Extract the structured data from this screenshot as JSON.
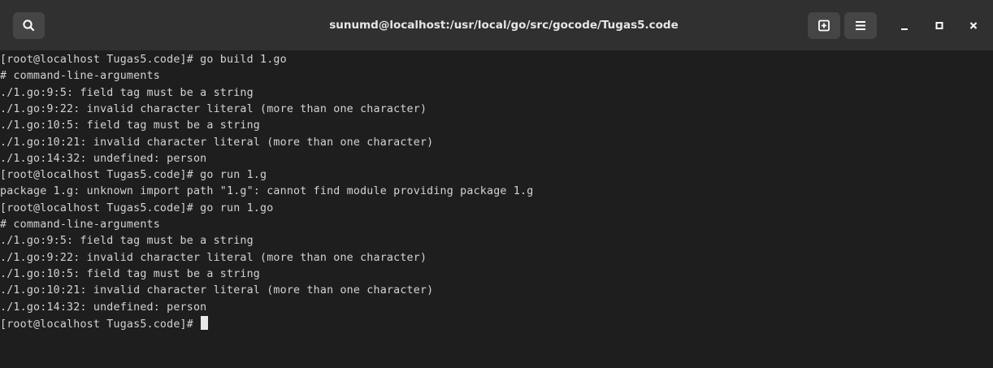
{
  "window": {
    "title": "sunumd@localhost:/usr/local/go/src/gocode/Tugas5.code"
  },
  "icons": {
    "search": "search-icon",
    "new_tab": "new-tab-icon",
    "menu": "hamburger-menu-icon",
    "minimize": "minimize-icon",
    "maximize": "maximize-icon",
    "close": "close-icon"
  },
  "colors": {
    "titlebar": "#303030",
    "background": "#1e1e1e",
    "text": "#d3d3d3"
  },
  "terminal": {
    "lines": [
      "[root@localhost Tugas5.code]# go build 1.go",
      "# command-line-arguments",
      "./1.go:9:5: field tag must be a string",
      "./1.go:9:22: invalid character literal (more than one character)",
      "./1.go:10:5: field tag must be a string",
      "./1.go:10:21: invalid character literal (more than one character)",
      "./1.go:14:32: undefined: person",
      "[root@localhost Tugas5.code]# go run 1.g",
      "package 1.g: unknown import path \"1.g\": cannot find module providing package 1.g",
      "[root@localhost Tugas5.code]# go run 1.go",
      "# command-line-arguments",
      "./1.go:9:5: field tag must be a string",
      "./1.go:9:22: invalid character literal (more than one character)",
      "./1.go:10:5: field tag must be a string",
      "./1.go:10:21: invalid character literal (more than one character)",
      "./1.go:14:32: undefined: person"
    ],
    "prompt": "[root@localhost Tugas5.code]# "
  }
}
